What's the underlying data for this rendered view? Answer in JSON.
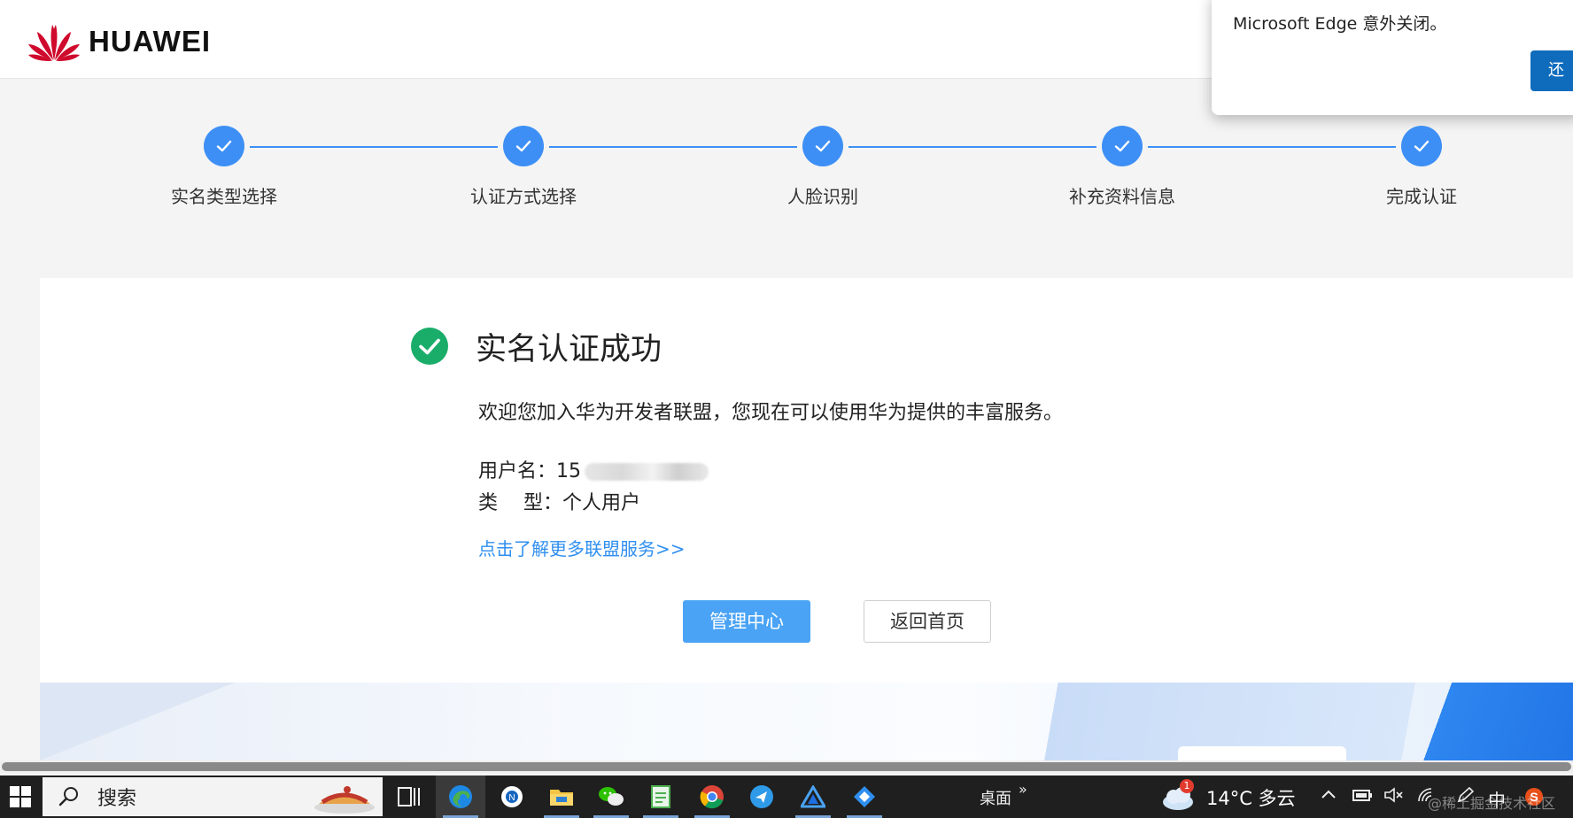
{
  "header": {
    "logo_text": "HUAWEI",
    "brand_color": "#cf0a2c"
  },
  "edge_popup": {
    "message": "Microsoft Edge 意外关闭。",
    "button_label": "还"
  },
  "steps": [
    {
      "label": "实名类型选择",
      "status": "completed"
    },
    {
      "label": "认证方式选择",
      "status": "completed"
    },
    {
      "label": "人脸识别",
      "status": "completed"
    },
    {
      "label": "补充资料信息",
      "status": "completed"
    },
    {
      "label": "完成认证",
      "status": "completed"
    }
  ],
  "result": {
    "title": "实名认证成功",
    "welcome": "欢迎您加入华为开发者联盟，您现在可以使用华为提供的丰富服务。",
    "username_label": "用户名：",
    "username_value": "15",
    "type_label": "类　 型：",
    "type_value": "个人用户",
    "learn_more": "点击了解更多联盟服务>>",
    "primary_button": "管理中心",
    "secondary_button": "返回首页"
  },
  "colors": {
    "accent": "#3d8ff5",
    "success": "#1aad6a",
    "primary_button": "#4aa3f5",
    "link": "#2f8ff0"
  },
  "taskbar": {
    "search_text": "搜索",
    "desktop_label": "桌面",
    "chevron": "»",
    "weather_badge": "1",
    "weather_text": "14°C 多云",
    "ime": "中",
    "watermark": "@稀土掘金技术社区",
    "apps": [
      "task-view-icon",
      "edge-icon",
      "app-icon",
      "file-explorer-icon",
      "wechat-icon",
      "notepad-icon",
      "chrome-icon",
      "feishu-icon",
      "deveco-icon",
      "vscode-icon"
    ]
  }
}
